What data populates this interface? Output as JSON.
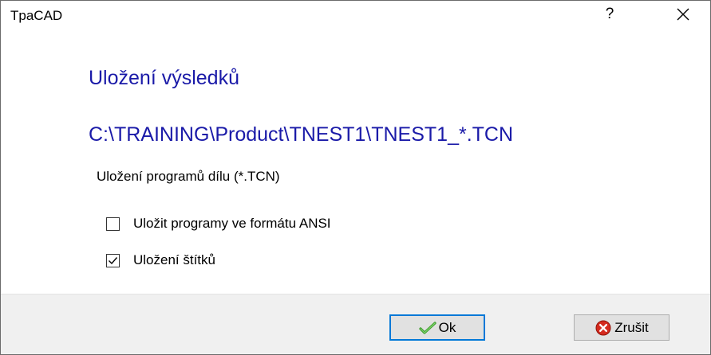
{
  "window": {
    "title": "TpaCAD",
    "help_label": "?"
  },
  "main": {
    "heading": "Uložení výsledků",
    "path": "C:\\TRAINING\\Product\\TNEST1\\TNEST1_*.TCN",
    "section_label": "Uložení programů dílu (*.TCN)",
    "options": [
      {
        "label": "Uložit programy ve formátu ANSI",
        "checked": false
      },
      {
        "label": "Uložení štítků",
        "checked": true
      }
    ]
  },
  "footer": {
    "ok_label": "Ok",
    "cancel_label": "Zrušit"
  },
  "colors": {
    "heading": "#1a1aa8",
    "ok_focus_border": "#0078d7",
    "footer_bg": "#f0f0f0"
  },
  "icons": {
    "help": "question-mark",
    "close": "close-icon",
    "ok": "green-check-icon",
    "cancel": "red-x-icon"
  }
}
